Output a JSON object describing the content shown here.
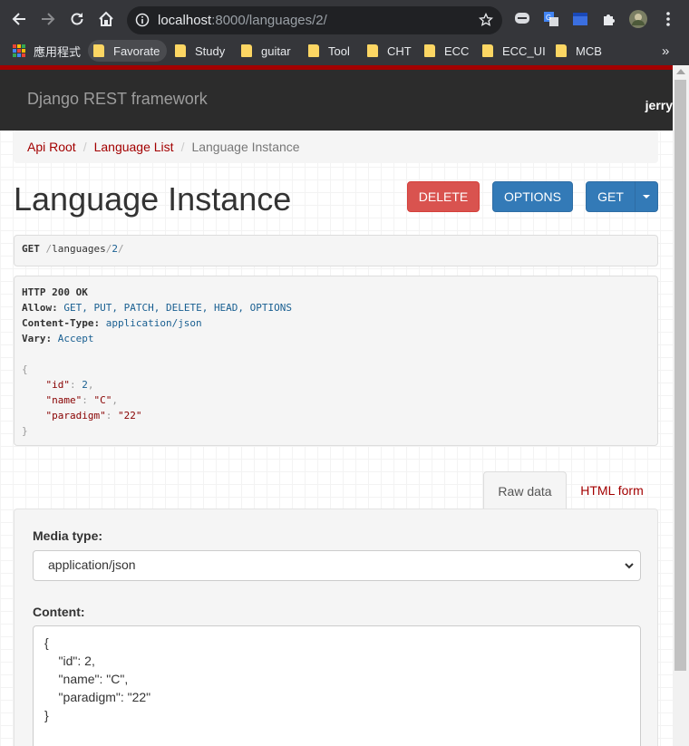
{
  "browser": {
    "url_host": "localhost",
    "url_path": ":8000/languages/2/",
    "bookmarks": [
      {
        "label": "應用程式",
        "type": "apps"
      },
      {
        "label": "Favorate",
        "type": "folder"
      },
      {
        "label": "Study",
        "type": "folder"
      },
      {
        "label": "guitar",
        "type": "folder"
      },
      {
        "label": "Tool",
        "type": "folder"
      },
      {
        "label": "CHT",
        "type": "folder"
      },
      {
        "label": "ECC",
        "type": "folder"
      },
      {
        "label": "ECC_UI",
        "type": "folder"
      },
      {
        "label": "MCB",
        "type": "folder"
      }
    ],
    "bookmarks_overflow": "»"
  },
  "navbar": {
    "brand": "Django REST framework",
    "user": "jerry"
  },
  "breadcrumb": {
    "items": [
      "Api Root",
      "Language List",
      "Language Instance"
    ],
    "separator": "/"
  },
  "page": {
    "title": "Language Instance",
    "buttons": {
      "delete": "DELETE",
      "options": "OPTIONS",
      "get": "GET"
    }
  },
  "request": {
    "method": "GET",
    "path_parts": [
      "/",
      "languages",
      "/",
      "2",
      "/"
    ]
  },
  "response": {
    "status_line": "HTTP 200 OK",
    "headers": [
      {
        "name": "Allow:",
        "value": "GET, PUT, PATCH, DELETE, HEAD, OPTIONS"
      },
      {
        "name": "Content-Type:",
        "value": "application/json"
      },
      {
        "name": "Vary:",
        "value": "Accept"
      }
    ],
    "body": {
      "id": 2,
      "name": "\"C\"",
      "paradigm": "\"22\""
    }
  },
  "form": {
    "tabs": [
      "Raw data",
      "HTML form"
    ],
    "active_tab": "Raw data",
    "media_type_label": "Media type:",
    "media_type_value": "application/json",
    "content_label": "Content:",
    "content_lines": [
      "{",
      "    \"id\": 2,",
      "    \"name\": \"C\",",
      "    \"paradigm\": \"22\"",
      "}"
    ]
  },
  "colors": {
    "brand_red": "#a30000",
    "delete_red": "#d9534f",
    "primary_blue": "#337ab7"
  }
}
